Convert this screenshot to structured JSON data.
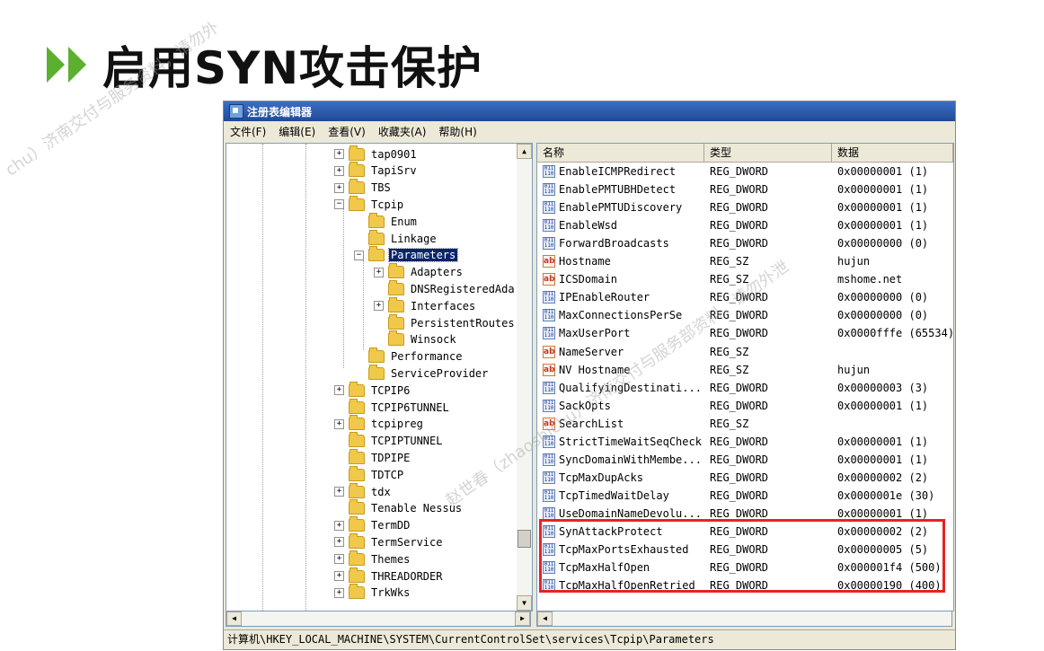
{
  "slide": {
    "title": "启用SYN攻击保护",
    "watermark_top": "chu）济南交付与服务资料，请勿外",
    "watermark_mid": "赵世春（zhaoshichu）济南交付与服务部资料，请勿外泄"
  },
  "window": {
    "title": "注册表编辑器",
    "menu": [
      "文件(F)",
      "编辑(E)",
      "查看(V)",
      "收藏夹(A)",
      "帮助(H)"
    ]
  },
  "tree": {
    "items": [
      {
        "label": "tap0901",
        "expander": "+"
      },
      {
        "label": "TapiSrv",
        "expander": "+"
      },
      {
        "label": "TBS",
        "expander": "+"
      },
      {
        "label": "Tcpip",
        "expander": "-"
      },
      {
        "label": "Enum",
        "expander": ""
      },
      {
        "label": "Linkage",
        "expander": ""
      },
      {
        "label": "Parameters",
        "expander": "-",
        "selected": true
      },
      {
        "label": "Adapters",
        "expander": "+"
      },
      {
        "label": "DNSRegisteredAda",
        "expander": ""
      },
      {
        "label": "Interfaces",
        "expander": "+"
      },
      {
        "label": "PersistentRoutes",
        "expander": ""
      },
      {
        "label": "Winsock",
        "expander": ""
      },
      {
        "label": "Performance",
        "expander": ""
      },
      {
        "label": "ServiceProvider",
        "expander": ""
      },
      {
        "label": "TCPIP6",
        "expander": "+"
      },
      {
        "label": "TCPIP6TUNNEL",
        "expander": ""
      },
      {
        "label": "tcpipreg",
        "expander": "+"
      },
      {
        "label": "TCPIPTUNNEL",
        "expander": ""
      },
      {
        "label": "TDPIPE",
        "expander": ""
      },
      {
        "label": "TDTCP",
        "expander": ""
      },
      {
        "label": "tdx",
        "expander": "+"
      },
      {
        "label": "Tenable Nessus",
        "expander": ""
      },
      {
        "label": "TermDD",
        "expander": "+"
      },
      {
        "label": "TermService",
        "expander": "+"
      },
      {
        "label": "Themes",
        "expander": "+"
      },
      {
        "label": "THREADORDER",
        "expander": "+"
      },
      {
        "label": "TrkWks",
        "expander": "+"
      }
    ]
  },
  "list": {
    "headers": {
      "name": "名称",
      "type": "类型",
      "data": "数据"
    },
    "rows": [
      {
        "name": "EnableICMPRedirect",
        "type": "REG_DWORD",
        "data": "0x00000001 (1)",
        "icon": "dword"
      },
      {
        "name": "EnablePMTUBHDetect",
        "type": "REG_DWORD",
        "data": "0x00000001 (1)",
        "icon": "dword"
      },
      {
        "name": "EnablePMTUDiscovery",
        "type": "REG_DWORD",
        "data": "0x00000001 (1)",
        "icon": "dword"
      },
      {
        "name": "EnableWsd",
        "type": "REG_DWORD",
        "data": "0x00000001 (1)",
        "icon": "dword"
      },
      {
        "name": "ForwardBroadcasts",
        "type": "REG_DWORD",
        "data": "0x00000000 (0)",
        "icon": "dword"
      },
      {
        "name": "Hostname",
        "type": "REG_SZ",
        "data": "hujun",
        "icon": "sz"
      },
      {
        "name": "ICSDomain",
        "type": "REG_SZ",
        "data": "mshome.net",
        "icon": "sz"
      },
      {
        "name": "IPEnableRouter",
        "type": "REG_DWORD",
        "data": "0x00000000 (0)",
        "icon": "dword"
      },
      {
        "name": "MaxConnectionsPerSe",
        "type": "REG_DWORD",
        "data": "0x00000000 (0)",
        "icon": "dword"
      },
      {
        "name": "MaxUserPort",
        "type": "REG_DWORD",
        "data": "0x0000fffe (65534)",
        "icon": "dword"
      },
      {
        "name": "NameServer",
        "type": "REG_SZ",
        "data": "",
        "icon": "sz"
      },
      {
        "name": "NV Hostname",
        "type": "REG_SZ",
        "data": "hujun",
        "icon": "sz"
      },
      {
        "name": "QualifyingDestinati...",
        "type": "REG_DWORD",
        "data": "0x00000003 (3)",
        "icon": "dword"
      },
      {
        "name": "SackOpts",
        "type": "REG_DWORD",
        "data": "0x00000001 (1)",
        "icon": "dword"
      },
      {
        "name": "SearchList",
        "type": "REG_SZ",
        "data": "",
        "icon": "sz"
      },
      {
        "name": "StrictTimeWaitSeqCheck",
        "type": "REG_DWORD",
        "data": "0x00000001 (1)",
        "icon": "dword"
      },
      {
        "name": "SyncDomainWithMembe...",
        "type": "REG_DWORD",
        "data": "0x00000001 (1)",
        "icon": "dword"
      },
      {
        "name": "TcpMaxDupAcks",
        "type": "REG_DWORD",
        "data": "0x00000002 (2)",
        "icon": "dword"
      },
      {
        "name": "TcpTimedWaitDelay",
        "type": "REG_DWORD",
        "data": "0x0000001e (30)",
        "icon": "dword"
      },
      {
        "name": "UseDomainNameDevolu...",
        "type": "REG_DWORD",
        "data": "0x00000001 (1)",
        "icon": "dword"
      },
      {
        "name": "SynAttackProtect",
        "type": "REG_DWORD",
        "data": "0x00000002 (2)",
        "icon": "dword"
      },
      {
        "name": "TcpMaxPortsExhausted",
        "type": "REG_DWORD",
        "data": "0x00000005 (5)",
        "icon": "dword"
      },
      {
        "name": "TcpMaxHalfOpen",
        "type": "REG_DWORD",
        "data": "0x000001f4 (500)",
        "icon": "dword"
      },
      {
        "name": "TcpMaxHalfOpenRetried",
        "type": "REG_DWORD",
        "data": "0x00000190 (400)",
        "icon": "dword"
      }
    ]
  },
  "status": {
    "path": "计算机\\HKEY_LOCAL_MACHINE\\SYSTEM\\CurrentControlSet\\services\\Tcpip\\Parameters"
  },
  "colors": {
    "accent": "#5bb030",
    "highlight": "#e82222",
    "selection": "#0a246a",
    "titlebar": "#214a95"
  }
}
